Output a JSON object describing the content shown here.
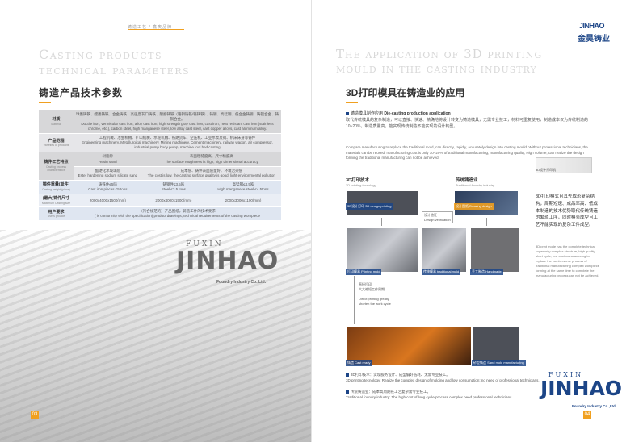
{
  "left": {
    "breadcrumb": "铸造工艺 / 鑫奥品牌",
    "title_en_1": "Casting products",
    "title_en_2": "technical parameters",
    "title_cn": "铸造产品技术参数",
    "table": [
      {
        "head": "材质",
        "sub": "Material",
        "cn": "球墨铸铁、蠕墨铸铁、合金铸铁、高强度灰口铸铁、耐磨铸铁（铬钼铸铁/铬铸铁）、铸钢、高锰钢、低合金铸钢、铸铝合金、铸铜合金。",
        "en": "Ductile iron, vermicular cast iron, alloy cast iron, high strength gray cast iron, cast iron, heat resistant cast iron (stainless chrome, etc.), carbon steel, high manganese steel, low alloy cast steel, cast copper alloys, cast aluminum alloy."
      },
      {
        "head": "产品范围",
        "sub": "Varieties of products",
        "cn": "工程机械、冶金机械、矿山机械、水泥机械、铁路货车、空压机、工业水泵及阀、机床床身等铸件",
        "en": "Engineering machinery, Metallurgical machinery, Mining machinery, Cement machinery, railway wagon, air compressor, industrial pump body pump, machine tool bed casting"
      },
      {
        "head": "铸件工艺特点",
        "sub": "Casting process characteristics",
        "cn1": "树脂砂",
        "en1": "Resin sand",
        "cn2": "表面粗糙度高、尺寸精度高",
        "en2": "The surface roughness is high, high dimensional accuracy"
      },
      {
        "cn1": "酯硬化水玻璃砂",
        "en1": "Ester hardening sodium silicate sand",
        "cn2": "成本低、铸件表面质量好、环境污染低",
        "en2": "The cost is low, the casting surface quality is good, light environmental pollution"
      },
      {
        "head": "铸件重量(单件)",
        "sub": "Casting weight (piece)",
        "cn1": "铸铁件≤5吨",
        "en1": "Cast iron pieces ≤5 tons",
        "cn2": "铸钢件≤3.5吨",
        "en2": "Steel ≤3.5 tons",
        "cn3": "高锰钢≤4.5吨",
        "en3": "High manganese steel ≤4.5tons"
      },
      {
        "head": "(最大)铸件尺寸",
        "sub": "Maximum Casting size",
        "v1": "2000x4000x1500(mm)",
        "v2": "2000x4000x1500(mm)",
        "v3": "2000x3000x1100(mm)"
      },
      {
        "head": "用户要求",
        "sub": "Users provide",
        "cn": "（符合规范的）产品图纸，铸造工件的技术要求",
        "en": "( is conformity with the specification) product drawings, technical requirements of the casting workpiece"
      }
    ],
    "watermark_1": "FUXIN",
    "watermark_2": "JINHAO",
    "watermark_3": "Foundry Industry Co.,Ltd.",
    "page_number": "03"
  },
  "right": {
    "logo_en": "JINHAO",
    "logo_cn": "金昊铸业",
    "title_en_1": "The application of 3D printing",
    "title_en_2": "mould in the casting industry",
    "title_cn": "3D打印模具在铸造业的应用",
    "section_head_cn": "铸造模具制作应用",
    "section_head_en": "Die-casting production application",
    "body_cn": "取代传统模具的复杂制造，可以直接、快速、精确地将设计转变为铸造模具，无需专业技工，材料可重复使用，制造成本仅为传统制造的10~20%，制造质量高，能实现传统制造不能实现的设计构型。",
    "body_en": "Compare manufacturing to replace the traditional mold, can directly, rapidly, accurately design into casting mould, Without professional technicians, the materials can be reused, manufacturing cost is only 10~20% of traditional manufacturing, manufacturing quality, High volume, can realize the design forming the traditional manufacturing can not be achieved.",
    "col1_title": "3D打印技术",
    "col1_sub": "3D printing tecnology",
    "col2_title": "传统铸造业",
    "col2_sub": "Traditional foundry industry",
    "cap_3d_print": "3D设计打印 3D design printing",
    "cap_design": "设计图纸  Drawing design",
    "label_design_verify": "设计验证",
    "label_design_verify_en": "Design verification",
    "cap_print_mold": "打印模具  Printing mold",
    "cap_trad_mold": "传统模具  traditional mold",
    "cap_handmade": "手工制造  Handmade",
    "note_direct_cn": "直接打印\n大大缩短工作周期",
    "note_direct_en": "Direct printing greatly shorten the work cycle",
    "cap_casting": "铸造  Cast ready",
    "cap_sand": "砂型铸造 Sand mold manufacturing",
    "side_label": "3D设计打印机",
    "side_head": "3D打印模式且其先成形复杂结构，周期短速、成品率高、低成本制造的技术优势取代传统铸造的繁琐工序，同时模壳成型且工艺不能实现的复杂工件成型。",
    "side_body": "3D print mode has the complete technical superiority complex structure, high quality, short cycle, low cost manufacturing to replace the cumbersome process of traditional manufacturing complex workpiece forming at the same time to complete the manufacturing process can not be achieved.",
    "foot1_cn": "3D打印技术：实现服务设计、成型偏好低耗、无需专业技工。",
    "foot1_en": "3D printing tecnology: Realize the complex design of molding and low consumption; no need of professional technicians.",
    "foot2_cn": "传统铸造业：成本高周期长工艺复杂需专业技工。",
    "foot2_en": "Traditional foundry industry: The high cost of long cycle process complex need professional technicians.",
    "watermark_1": "FUXIN",
    "watermark_2": "JINHAO",
    "watermark_3": "Foundry Industry Co.,Ltd.",
    "page_number": "04"
  },
  "colors": {
    "accent": "#f0a020",
    "brand": "#1c4587"
  }
}
